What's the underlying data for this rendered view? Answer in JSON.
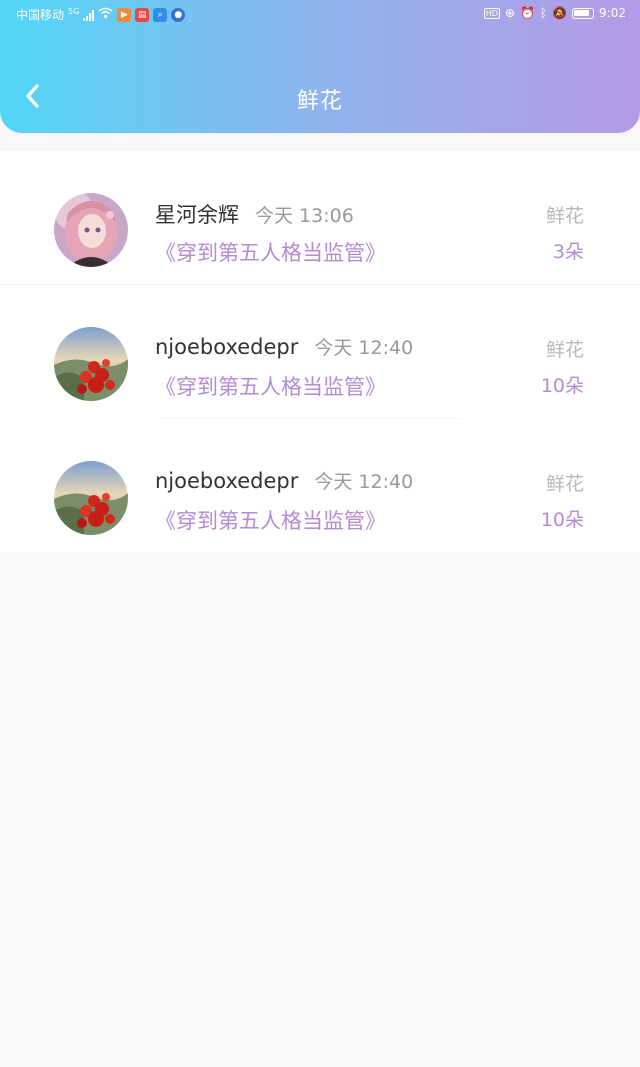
{
  "status_bar": {
    "carrier": "中国移动",
    "network": "5G",
    "time": "9:02",
    "hd_badge": "HD"
  },
  "header": {
    "title": "鲜花",
    "back_icon": "chevron-left-icon"
  },
  "colors": {
    "header_gradient": [
      "#52d6f6",
      "#b69ae8"
    ],
    "accent_purple": "#b58bd3"
  },
  "records": [
    {
      "user": "星河余辉",
      "time": "今天 13:06",
      "book": "《穿到第五人格当监管》",
      "gift_type": "鲜花",
      "count": "3朵",
      "avatar": "anime-girl-avatar"
    },
    {
      "user": "njoeboxedepr",
      "time": "今天 12:40",
      "book": "《穿到第五人格当监管》",
      "gift_type": "鲜花",
      "count": "10朵",
      "avatar": "red-flowers-landscape-avatar"
    },
    {
      "user": "njoeboxedepr",
      "time": "今天 12:40",
      "book": "《穿到第五人格当监管》",
      "gift_type": "鲜花",
      "count": "10朵",
      "avatar": "red-flowers-landscape-avatar"
    }
  ]
}
